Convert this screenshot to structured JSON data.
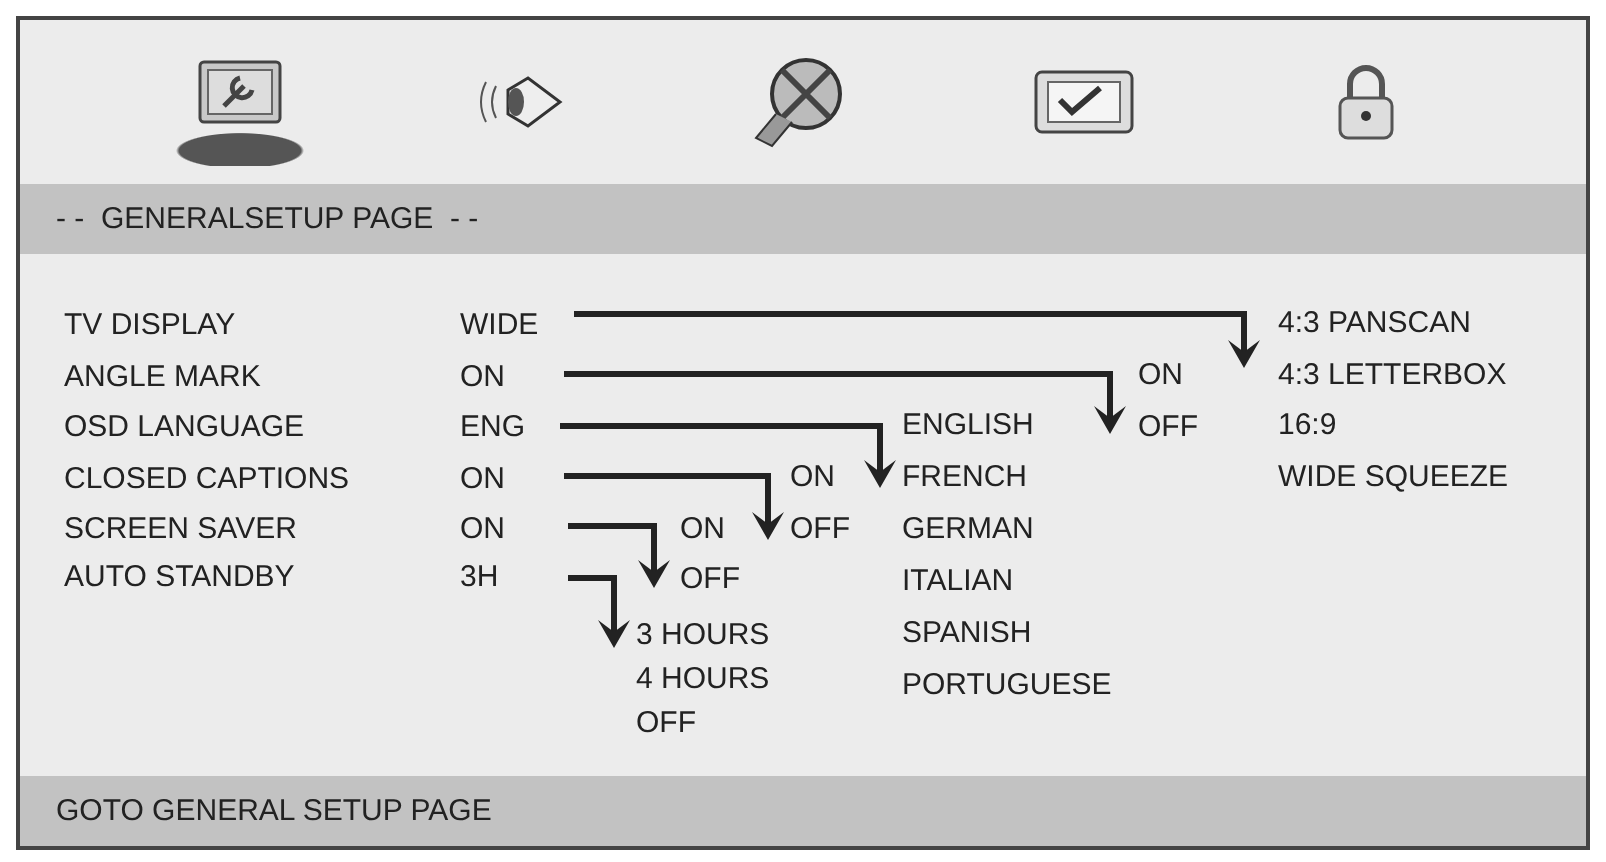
{
  "tabs": [
    {
      "kind": "general",
      "selected": true
    },
    {
      "kind": "audio",
      "selected": false
    },
    {
      "kind": "video",
      "selected": false
    },
    {
      "kind": "preference",
      "selected": false
    },
    {
      "kind": "password",
      "selected": false
    }
  ],
  "header": "- -  GENERALSETUP PAGE  - -",
  "settings": [
    {
      "label": "TV DISPLAY",
      "value": "WIDE",
      "options": [
        "4:3 PANSCAN",
        "4:3 LETTERBOX",
        "16:9",
        "WIDE SQUEEZE"
      ]
    },
    {
      "label": "ANGLE MARK",
      "value": "ON",
      "options": [
        "ON",
        "OFF"
      ]
    },
    {
      "label": "OSD LANGUAGE",
      "value": "ENG",
      "options": [
        "ENGLISH",
        "FRENCH",
        "GERMAN",
        "ITALIAN",
        "SPANISH",
        "PORTUGUESE"
      ]
    },
    {
      "label": "CLOSED CAPTIONS",
      "value": "ON",
      "options": [
        "ON",
        "OFF"
      ]
    },
    {
      "label": "SCREEN SAVER",
      "value": "ON",
      "options": [
        "ON",
        "OFF"
      ]
    },
    {
      "label": "AUTO STANDBY",
      "value": "3H",
      "options": [
        "3 HOURS",
        "4 HOURS",
        "OFF"
      ]
    }
  ],
  "status_bar": "GOTO GENERAL SETUP PAGE"
}
